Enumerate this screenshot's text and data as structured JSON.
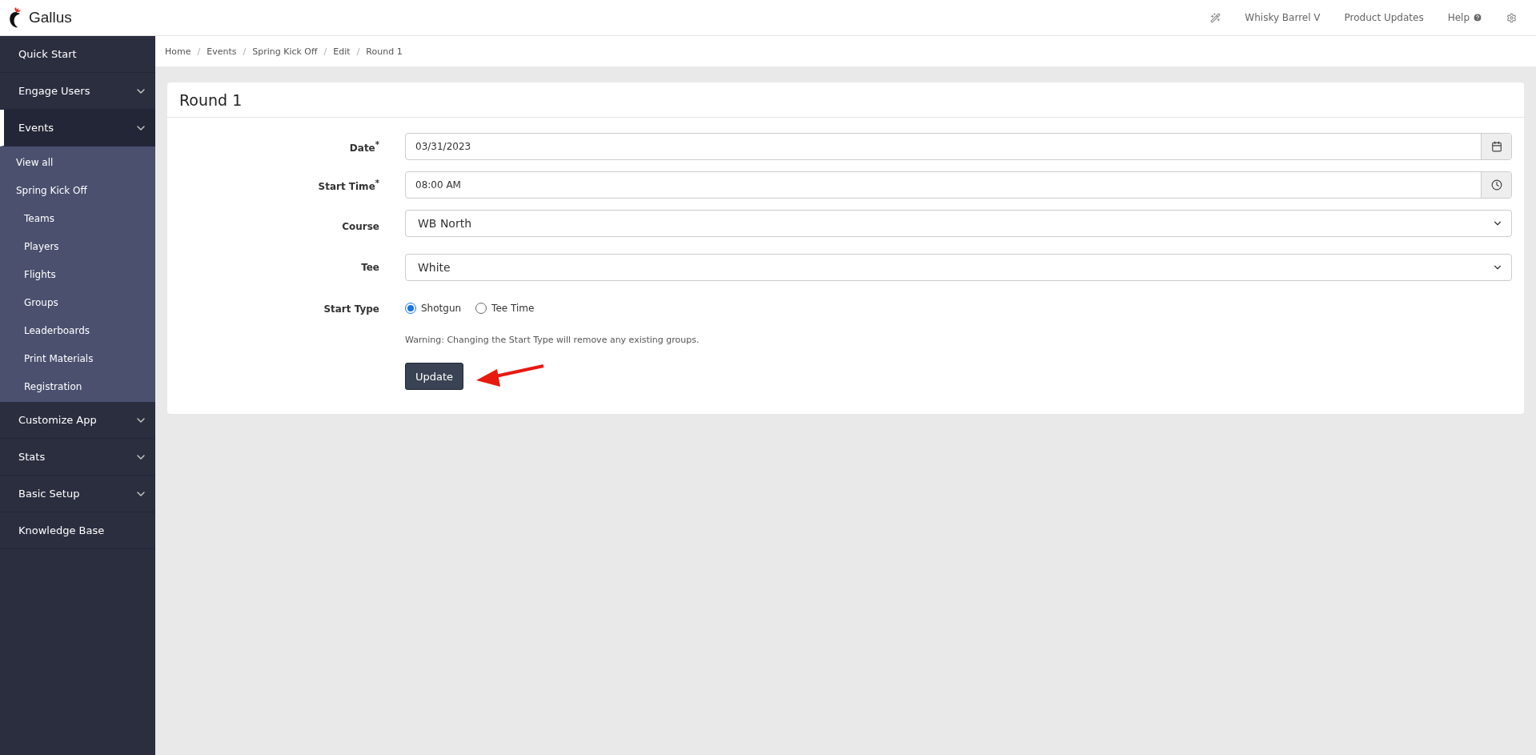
{
  "header": {
    "brand": "Gallus",
    "links": [
      {
        "label": "Whisky Barrel V",
        "kind": "text"
      },
      {
        "label": "Product Updates",
        "kind": "text"
      },
      {
        "label": "Help",
        "kind": "help"
      }
    ]
  },
  "sidebar": {
    "items": [
      {
        "label": "Quick Start",
        "expandable": false,
        "selected": false
      },
      {
        "label": "Engage Users",
        "expandable": true,
        "selected": false
      },
      {
        "label": "Events",
        "expandable": true,
        "selected": true,
        "children": [
          {
            "label": "View all"
          },
          {
            "label": "Spring Kick Off",
            "children": [
              {
                "label": "Teams"
              },
              {
                "label": "Players"
              },
              {
                "label": "Flights"
              },
              {
                "label": "Groups"
              },
              {
                "label": "Leaderboards"
              },
              {
                "label": "Print Materials"
              },
              {
                "label": "Registration"
              }
            ]
          }
        ]
      },
      {
        "label": "Customize App",
        "expandable": true,
        "selected": false
      },
      {
        "label": "Stats",
        "expandable": true,
        "selected": false
      },
      {
        "label": "Basic Setup",
        "expandable": true,
        "selected": false
      },
      {
        "label": "Knowledge Base",
        "expandable": false,
        "selected": false
      }
    ]
  },
  "breadcrumb": [
    {
      "label": "Home"
    },
    {
      "separator": "/",
      "label": "Events"
    },
    {
      "separator": "/",
      "label": "Spring Kick Off"
    },
    {
      "separator": "/",
      "label": "Edit"
    },
    {
      "separator": "/",
      "label": "Round 1"
    }
  ],
  "card": {
    "title": "Round 1",
    "fields": [
      {
        "kind": "date",
        "label": "Date$^{*}$",
        "value": "03/31/2023"
      },
      {
        "kind": "time",
        "label": "Start Time$^{*}$",
        "value": "08:00 AM"
      },
      {
        "kind": "select",
        "label": "Course",
        "value": "WB North"
      },
      {
        "kind": "select",
        "label": "Tee",
        "value": "White"
      },
      {
        "kind": "radio",
        "label": "Start Type",
        "options": [
          {
            "label": "Shotgun",
            "selected": true
          },
          {
            "label": "Tee Time",
            "selected": false
          }
        ]
      }
    ],
    "warning": "Warning: Changing the Start Type will remove any existing groups.",
    "button": "Update"
  }
}
